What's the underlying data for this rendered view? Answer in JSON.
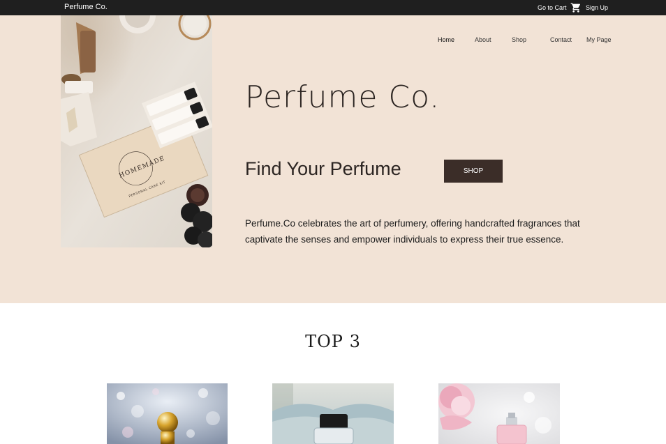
{
  "topbar": {
    "brand": "Perfume Co.",
    "cart_label": "Go to Cart",
    "cart_icon": "shopping-cart-icon",
    "signup_label": "Sign Up"
  },
  "nav": {
    "items": [
      "Home",
      "About",
      "Shop",
      "Contact",
      "My Page"
    ],
    "active": "Home"
  },
  "hero": {
    "title": "Perfume Co.",
    "tagline": "Find Your Perfume",
    "shop_button": "SHOP",
    "description": "Perfume.Co celebrates the art of perfumery, offering handcrafted fragrances that captivate the senses and empower individuals to express their true essence.",
    "box_brand": "HOMEMADE",
    "box_subtitle": "PERSONAL CARE KIT"
  },
  "section": {
    "title": "TOP 3"
  },
  "colors": {
    "topbar": "#1f1f1f",
    "hero_bg": "#f2e3d6",
    "button": "#3b2d28"
  }
}
